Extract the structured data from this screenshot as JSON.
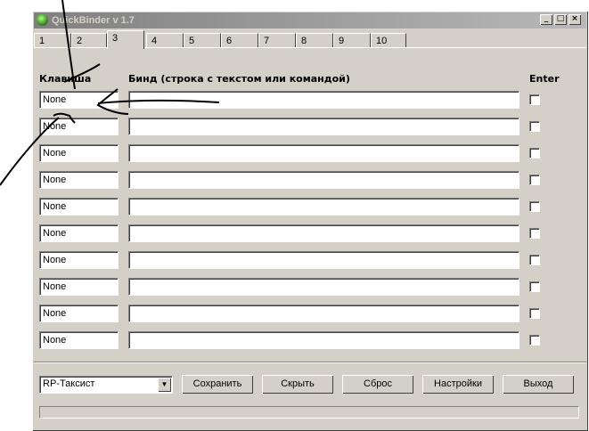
{
  "window": {
    "title": "QuickBinder v 1.7"
  },
  "tabs": [
    "1",
    "2",
    "3",
    "4",
    "5",
    "6",
    "7",
    "8",
    "9",
    "10"
  ],
  "active_tab": "3",
  "headers": {
    "key": "Клавиша",
    "bind": "Бинд (строка с текстом или командой)",
    "enter": "Enter"
  },
  "rows": [
    {
      "key": "None",
      "bind": "",
      "enter": false
    },
    {
      "key": "None",
      "bind": "",
      "enter": false
    },
    {
      "key": "None",
      "bind": "",
      "enter": false
    },
    {
      "key": "None",
      "bind": "",
      "enter": false
    },
    {
      "key": "None",
      "bind": "",
      "enter": false
    },
    {
      "key": "None",
      "bind": "",
      "enter": false
    },
    {
      "key": "None",
      "bind": "",
      "enter": false
    },
    {
      "key": "None",
      "bind": "",
      "enter": false
    },
    {
      "key": "None",
      "bind": "",
      "enter": false
    },
    {
      "key": "None",
      "bind": "",
      "enter": false
    }
  ],
  "footer": {
    "profile": "RP-Таксист",
    "buttons": {
      "save": "Сохранить",
      "hide": "Скрыть",
      "reset": "Сброс",
      "settings": "Настройки",
      "exit": "Выход"
    }
  },
  "icons": {
    "app": "app-icon",
    "minimize": "minimize-icon",
    "maximize": "maximize-icon",
    "close": "close-icon",
    "dropdown": "chevron-down-icon"
  }
}
